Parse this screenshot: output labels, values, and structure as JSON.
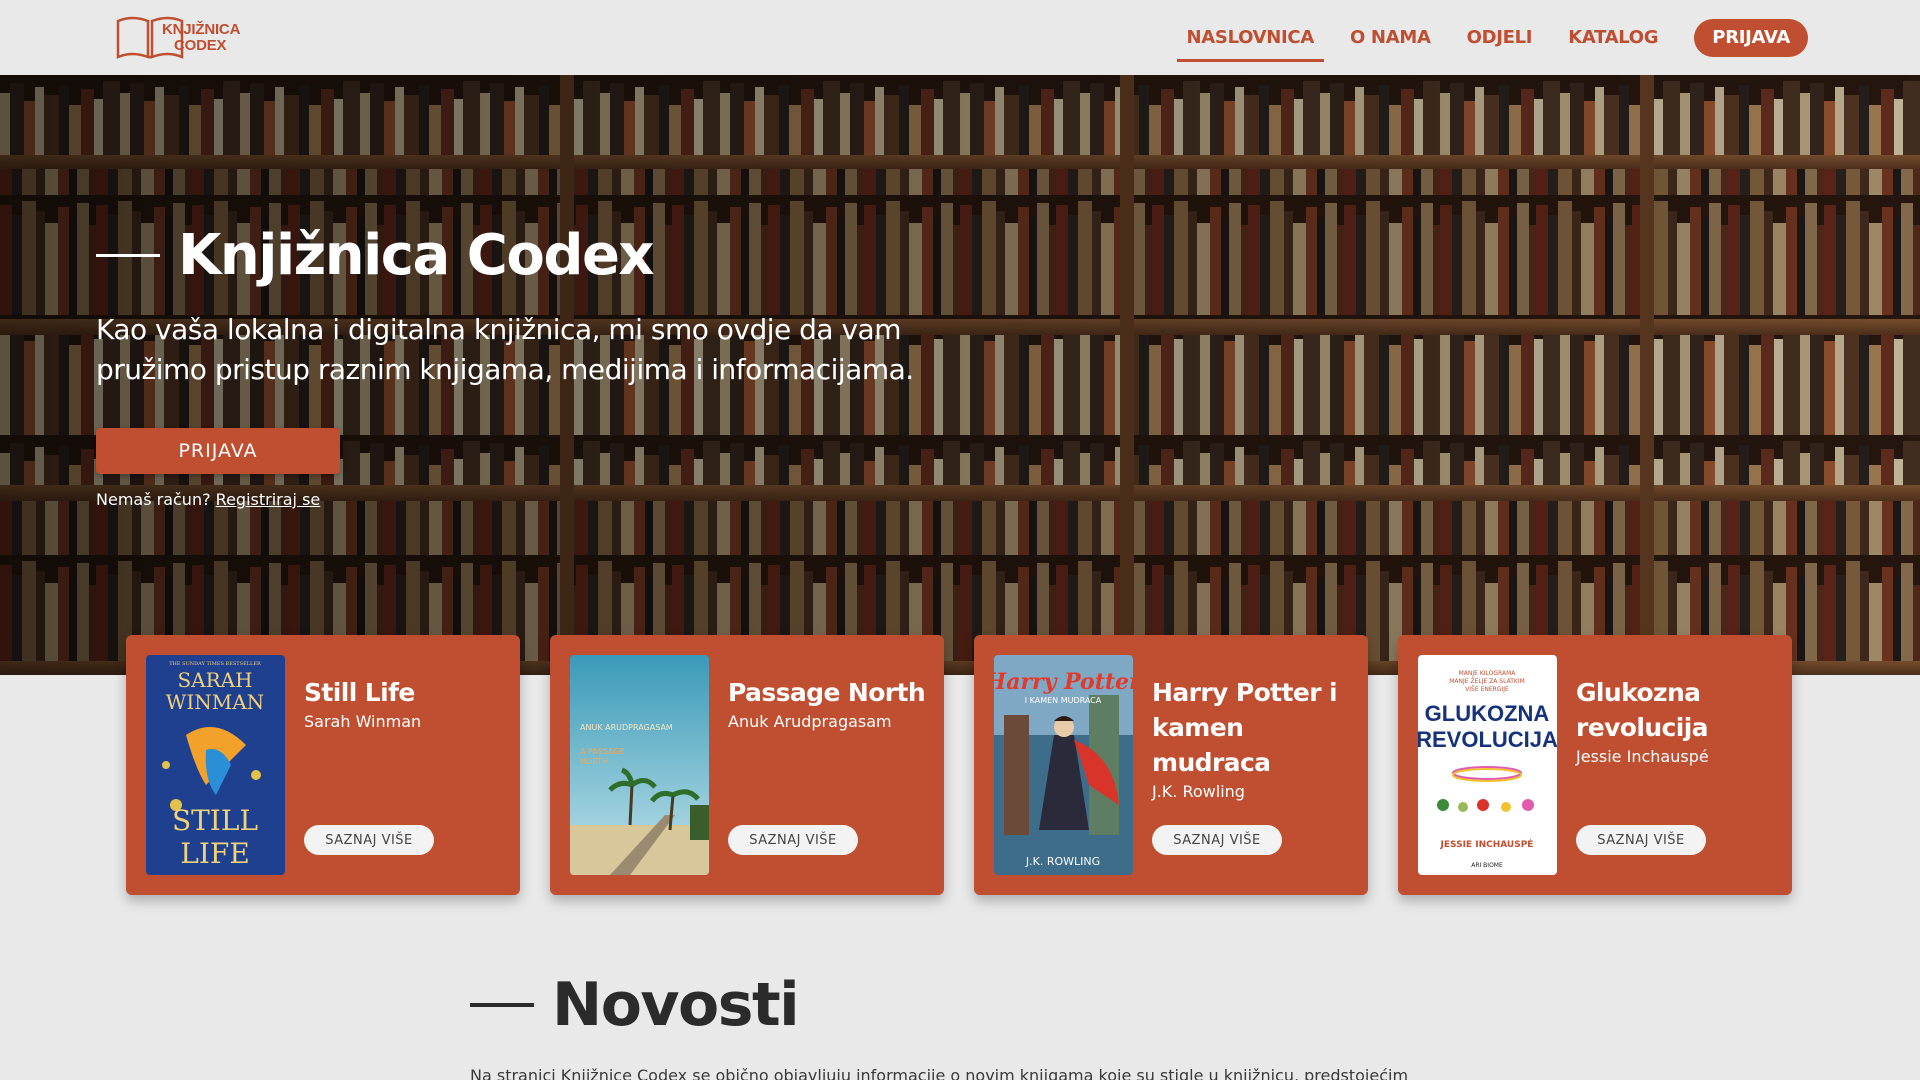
{
  "brand": {
    "logo_line1": "KNJIŽNICA",
    "logo_line2": "CODEX",
    "accent_color": "#c04e30"
  },
  "nav": {
    "items": [
      {
        "label": "NASLOVNICA",
        "active": true
      },
      {
        "label": "O NAMA",
        "active": false
      },
      {
        "label": "ODJELI",
        "active": false
      },
      {
        "label": "KATALOG",
        "active": false
      }
    ],
    "login_label": "PRIJAVA"
  },
  "hero": {
    "title": "Knjižnica Codex",
    "subtitle": "Kao vaša lokalna i digitalna knjižnica, mi smo ovdje da vam pružimo pristup raznim knjigama, medijima i informacijama.",
    "button_label": "PRIJAVA",
    "register_prompt": "Nemaš račun?",
    "register_link": "Registriraj se"
  },
  "books": [
    {
      "title": "Still Life",
      "author": "Sarah Winman",
      "button": "SAZNAJ VIŠE",
      "cover": {
        "top_text": "THE SUNDAY TIMES BESTSELLER",
        "name_line1": "SARAH",
        "name_line2": "WINMAN",
        "title_line1": "STILL",
        "title_line2": "LIFE",
        "color": "#1f3f8f"
      }
    },
    {
      "title": "Passage North",
      "author": "Anuk Arudpragasam",
      "button": "SAZNAJ VIŠE",
      "cover": {
        "author": "ANUK ARUDPRAGASAM",
        "title_line1": "A PASSAGE",
        "title_line2": "NORTH",
        "color": "#2e8aa8"
      }
    },
    {
      "title": "Harry Potter i kamen mudraca",
      "author": "J.K. Rowling",
      "button": "SAZNAJ VIŠE",
      "cover": {
        "title": "Harry Potter",
        "subtitle": "I KAMEN MUDRACA",
        "author": "J.K. ROWLING",
        "color": "#3d6d8a"
      }
    },
    {
      "title": "Glukozna revolucija",
      "author": "Jessie Inchauspé",
      "button": "SAZNAJ VIŠE",
      "cover": {
        "tagline_line1": "MANJE KILOGRAMA",
        "tagline_line2": "MANJE ŽELJE ZA SLATKIM",
        "tagline_line3": "VIŠE ENERGIJE",
        "title_line1": "GLUKOZNA",
        "title_line2": "REVOLUCIJA",
        "author": "JESSIE INCHAUSPÉ",
        "publisher": "ARI BIOME",
        "color": "#ffffff"
      }
    }
  ],
  "news": {
    "title": "Novosti",
    "text": "Na stranici Knjižnice Codex se obično objavljuju informacije o novim knjigama koje su stigle u knjižnicu, predstojećim"
  }
}
